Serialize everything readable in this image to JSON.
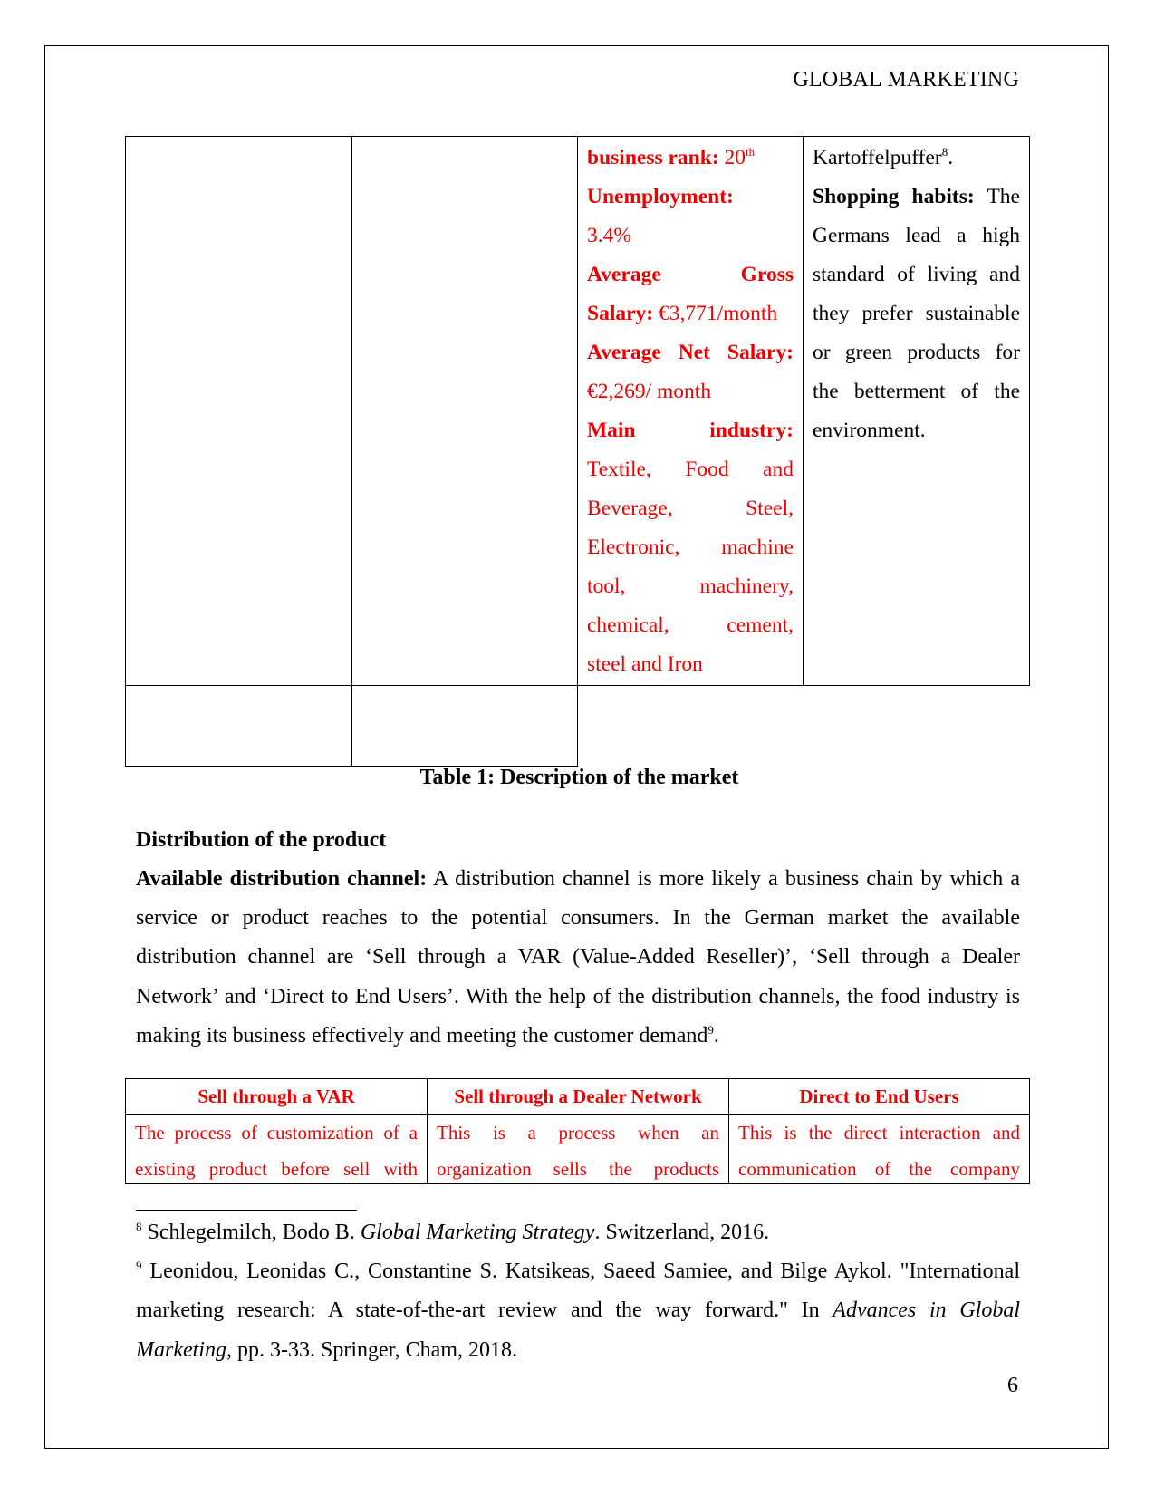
{
  "header": {
    "running_title": "GLOBAL MARKETING"
  },
  "table1": {
    "row1": {
      "col3": {
        "business_rank_label": "business rank:",
        "business_rank_value": "20",
        "business_rank_suffix": "th",
        "unemployment_label": "Unemployment:",
        "unemployment_value": "3.4%",
        "gross_label_word1": "Average",
        "gross_label_word2": "Gross",
        "gross_label_line2": "Salary:",
        "gross_value": "€3,771/month",
        "net_label": "Average Net Salary:",
        "net_value": "€2,269/ month",
        "industry_label_word1": "Main",
        "industry_label_word2": "industry:",
        "industry_lines": [
          "Textile, Food and",
          "Beverage, Steel,",
          "Electronic, machine",
          "tool, machinery,",
          "chemical, cement,",
          "steel and Iron"
        ]
      },
      "col4": {
        "carryover_text": "Kartoffelpuffer",
        "carryover_footnote": "8",
        "carryover_end": ".",
        "shopping_label": "Shopping habits:",
        "shopping_text": "The Germans lead a high standard of living and they prefer sustainable or green products for the betterment of the environment."
      }
    },
    "caption": "Table 1: Description of the market"
  },
  "section": {
    "heading": "Distribution of the product",
    "paragraph_label": "Available distribution channel:",
    "paragraph_text": "A distribution channel is more likely a business chain by which a service or product reaches to the potential consumers. In the German market the available distribution channel are ‘Sell through a VAR (Value-Added Reseller)’, ‘Sell through a Dealer Network’ and ‘Direct to End Users’. With the help of the distribution channels, the food industry is making its business effectively and meeting the customer demand",
    "paragraph_footnote": "9",
    "paragraph_end": "."
  },
  "table2": {
    "headers": [
      "Sell through a VAR",
      "Sell through a Dealer Network",
      "Direct to End Users"
    ],
    "cells": [
      "The process of customization of a existing product before sell with",
      "This is a process when an organization sells the products",
      "This is the direct interaction and communication of the company"
    ]
  },
  "footnotes": [
    {
      "number": "8",
      "text_before": "Schlegelmilch, Bodo B. ",
      "italic": "Global Marketing Strategy",
      "text_after": ". Switzerland, 2016."
    },
    {
      "number": "9",
      "text_before": "Leonidou, Leonidas C., Constantine S. Katsikeas, Saeed Samiee, and Bilge Aykol. \"International marketing research: A state-of-the-art review and the way forward.\" In ",
      "italic": "Advances in Global Marketing",
      "text_after": ", pp. 3-33. Springer, Cham, 2018."
    }
  ],
  "page_number": "6",
  "colors": {
    "highlight_red": "#ee0000",
    "text": "#000000",
    "border": "#000000"
  }
}
